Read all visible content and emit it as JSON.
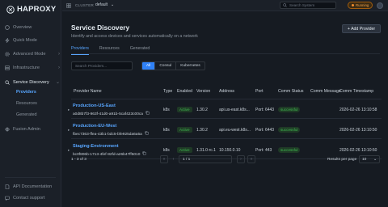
{
  "brand": {
    "name": "HAPROXY"
  },
  "header": {
    "cluster_label": "CLUSTER",
    "cluster_value": "default",
    "search_placeholder": "Search System",
    "status_label": "Running",
    "accent": "#f08c2e"
  },
  "sidebar": {
    "items": [
      {
        "label": "Overview",
        "icon": "overview-icon"
      },
      {
        "label": "Quick Mode",
        "icon": "quick-mode-icon"
      },
      {
        "label": "Advanced Mode",
        "icon": "advanced-mode-icon"
      },
      {
        "label": "Infrastructure",
        "icon": "infrastructure-icon"
      },
      {
        "label": "Service Discovery",
        "icon": "service-discovery-icon"
      },
      {
        "label": "Fusion Admin",
        "icon": "fusion-admin-icon"
      }
    ],
    "sub_items": [
      "Providers",
      "Resources",
      "Generated"
    ],
    "footer": [
      {
        "label": "API Documentation",
        "icon": "document-icon"
      },
      {
        "label": "Contact support",
        "icon": "support-icon"
      }
    ]
  },
  "page": {
    "title": "Service Discovery",
    "description": "Identify and access devices and services automatically on a network",
    "add_button": "+ Add Provider",
    "tabs": [
      "Providers",
      "Resources",
      "Generated"
    ]
  },
  "filters": {
    "search_placeholder": "Search Providers...",
    "segments": [
      "All",
      "Consul",
      "Kubernetes"
    ]
  },
  "table": {
    "columns": [
      "Provider Name",
      "Type",
      "Enabled",
      "Version",
      "Address",
      "Port",
      "Comm Status",
      "Comm Message",
      "Comm Timestamp"
    ],
    "rows": [
      {
        "name": "Production-US-East",
        "id": "a0d8b7f3-963f-41d0-a91b-5caf423c00ca",
        "type": "k8s",
        "enabled": "Active",
        "version": "1.30.2",
        "address": "api.us-east.k8s...",
        "port": "Port: 6443",
        "comm_status": "successful",
        "comm_message": "",
        "timestamp": "2026-02-26 13:10:58"
      },
      {
        "name": "Production-EU-West",
        "id": "fbec7363-ffea-43b1-bdc5-bfe925da6a5a",
        "type": "k8s",
        "enabled": "Active",
        "version": "1.30.2",
        "address": "api.eu-west.k8s...",
        "port": "Port: 6443",
        "comm_status": "successful",
        "comm_message": "",
        "timestamp": "2026-02-26 13:10:50"
      },
      {
        "name": "Staging-Environment",
        "id": "bc0f806b-1713-4fef-82fd-a26b47ff5010",
        "type": "k8s",
        "enabled": "Active",
        "version": "1.31.0-rc.1",
        "address": "10.150.0.10",
        "port": "Port: 443",
        "comm_status": "successful",
        "comm_message": "",
        "timestamp": "2026-02-26 13:10:50"
      }
    ]
  },
  "pagination": {
    "range": "1 - 3 of 3",
    "page_select": "1 / 1",
    "rpp_label": "Results per page",
    "rpp_value": "10"
  }
}
